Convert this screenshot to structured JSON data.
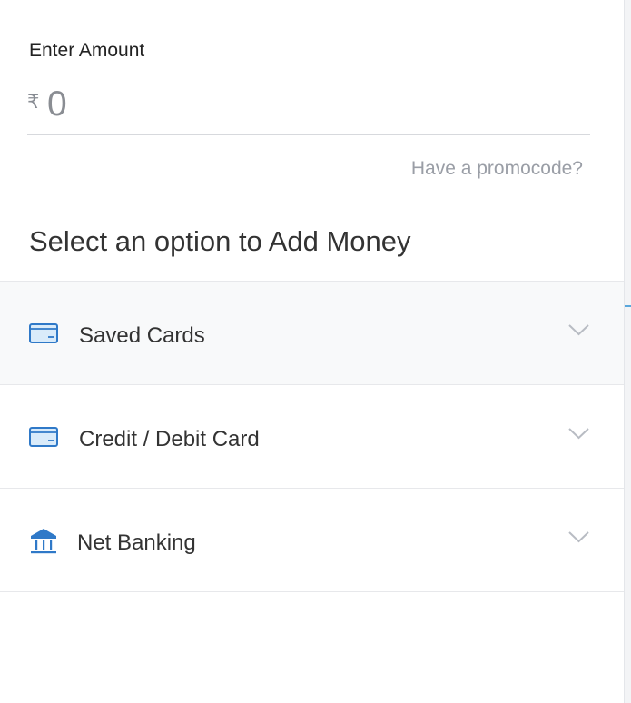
{
  "amount": {
    "label": "Enter Amount",
    "currency_symbol": "₹",
    "value": "",
    "placeholder": "0"
  },
  "promo_link": "Have a promocode?",
  "section_title": "Select an option to Add Money",
  "options": [
    {
      "label": "Saved Cards",
      "icon": "card-icon"
    },
    {
      "label": "Credit / Debit Card",
      "icon": "card-icon"
    },
    {
      "label": "Net Banking",
      "icon": "bank-icon"
    }
  ],
  "colors": {
    "accent": "#2f79c8",
    "divider": "#e7e8eb",
    "text": "#333333",
    "muted": "#9a9ea6"
  }
}
